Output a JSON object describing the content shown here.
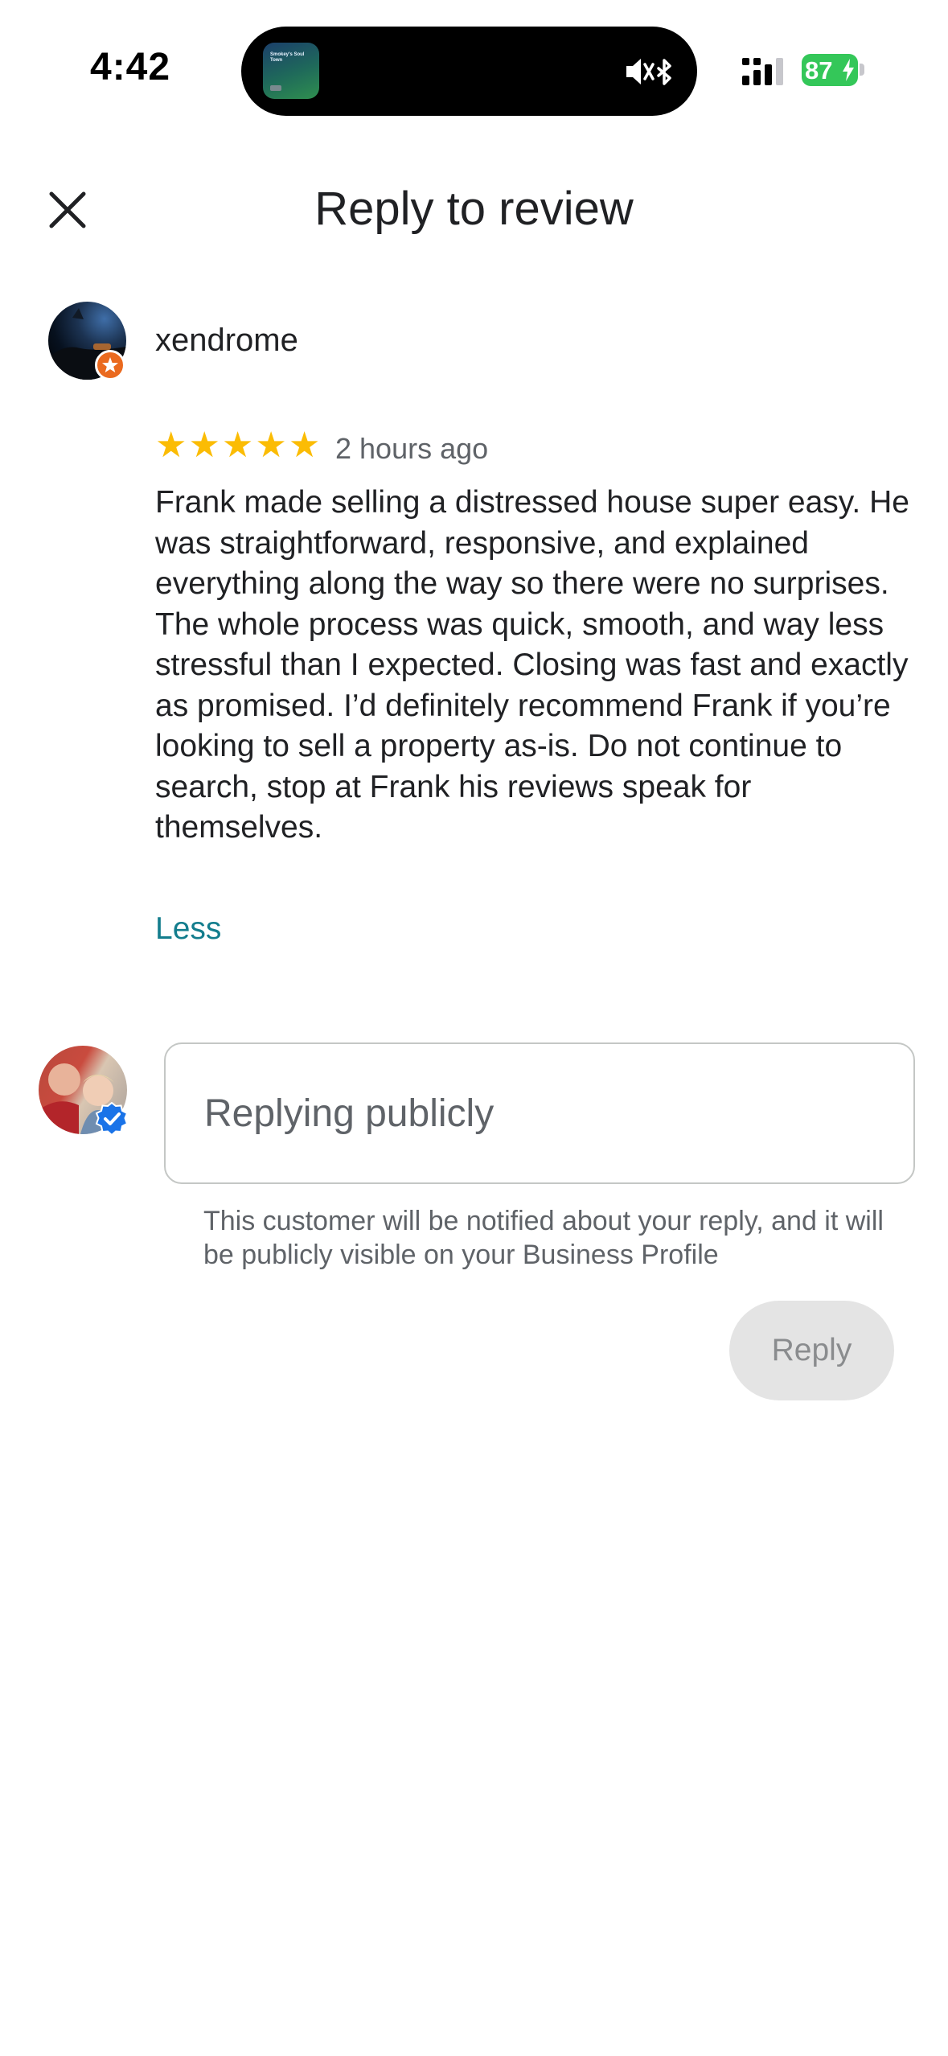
{
  "status_bar": {
    "time": "4:42",
    "battery": "87",
    "live_activity_art_text": "Smokey's Soul Town",
    "icons": [
      "mute-icon",
      "bluetooth-icon",
      "signal-icon",
      "battery-icon"
    ]
  },
  "header": {
    "title": "Reply to review",
    "close_icon": "close-icon"
  },
  "review": {
    "author": "xendrome",
    "rating": 5,
    "stars": [
      "★",
      "★",
      "★",
      "★",
      "★"
    ],
    "time_ago": "2 hours ago",
    "text": "Frank made selling a distressed house super easy. He was straightforward, responsive, and explained everything along the way so there were no surprises. The whole process was quick, smooth, and way less stressful than I expected. Closing was fast and exactly as promised. I’d definitely recommend Frank if you’re looking to sell a property as-is. Do not continue to search, stop at Frank his reviews speak for themselves.",
    "less_label": "Less"
  },
  "reply": {
    "value": "",
    "placeholder": "Replying publicly",
    "notice": "This customer will be notified about your reply, and it will be publicly visible on your Business Profile",
    "button_label": "Reply"
  },
  "colors": {
    "star": "#fbbc04",
    "link": "#137d8d",
    "verified_badge": "#1a73e8",
    "local_guide_badge": "#ea6a1f",
    "battery": "#34c759"
  }
}
